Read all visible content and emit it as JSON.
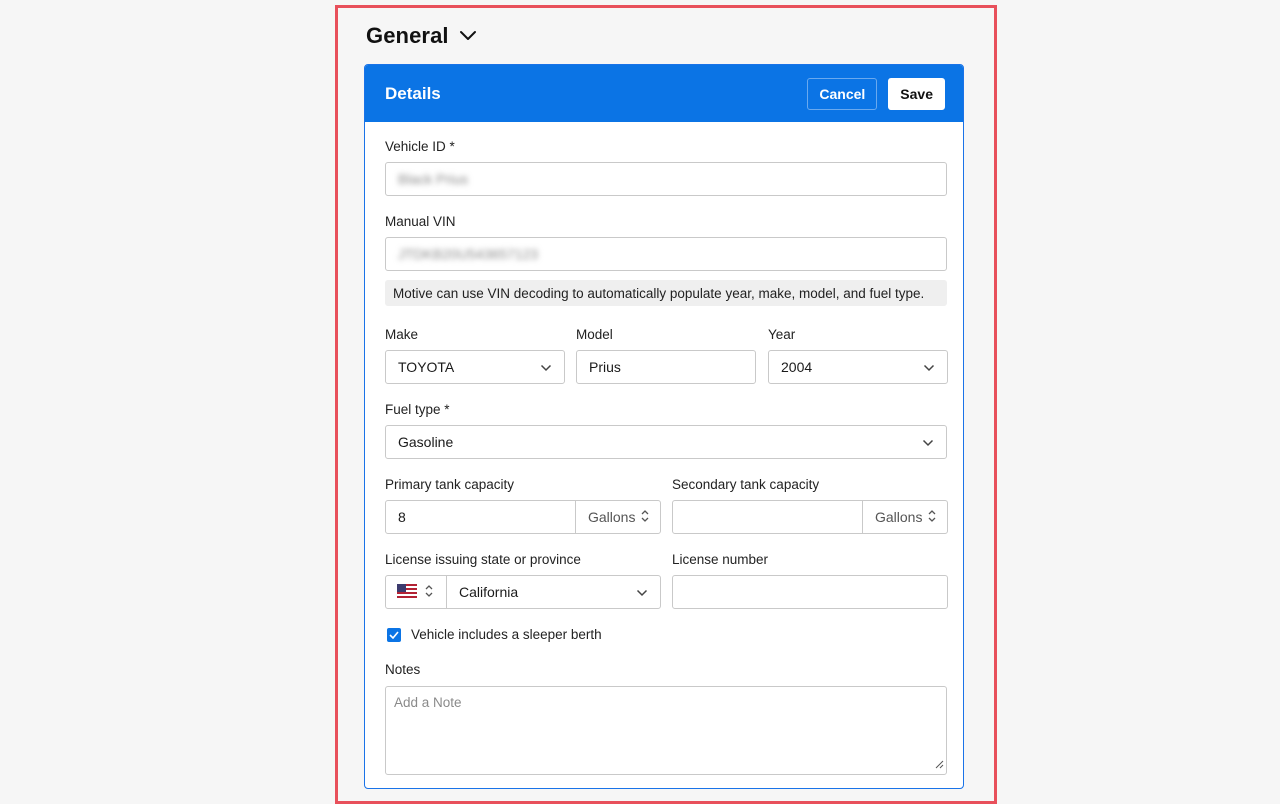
{
  "section": {
    "title": "General"
  },
  "card": {
    "title": "Details",
    "cancel_label": "Cancel",
    "save_label": "Save"
  },
  "fields": {
    "vehicle_id": {
      "label": "Vehicle ID *",
      "value": "Black Prius"
    },
    "manual_vin": {
      "label": "Manual VIN",
      "value": "JTDKB20U543657123"
    },
    "vin_hint": "Motive can use VIN decoding to automatically populate year, make, model, and fuel type.",
    "make": {
      "label": "Make",
      "value": "TOYOTA"
    },
    "model": {
      "label": "Model",
      "value": "Prius"
    },
    "year": {
      "label": "Year",
      "value": "2004"
    },
    "fuel_type": {
      "label": "Fuel type *",
      "value": "Gasoline"
    },
    "primary_tank": {
      "label": "Primary tank capacity",
      "value": "8",
      "unit": "Gallons"
    },
    "secondary_tank": {
      "label": "Secondary tank capacity",
      "value": "",
      "unit": "Gallons"
    },
    "license_state": {
      "label": "License issuing state or province",
      "value": "California",
      "country_icon": "us-flag-icon"
    },
    "license_number": {
      "label": "License number",
      "value": ""
    },
    "sleeper_berth": {
      "label": "Vehicle includes a sleeper berth",
      "checked": true
    },
    "notes": {
      "label": "Notes",
      "placeholder": "Add a Note",
      "value": ""
    }
  },
  "colors": {
    "accent": "#0b74e5",
    "highlight": "#e8505b"
  }
}
